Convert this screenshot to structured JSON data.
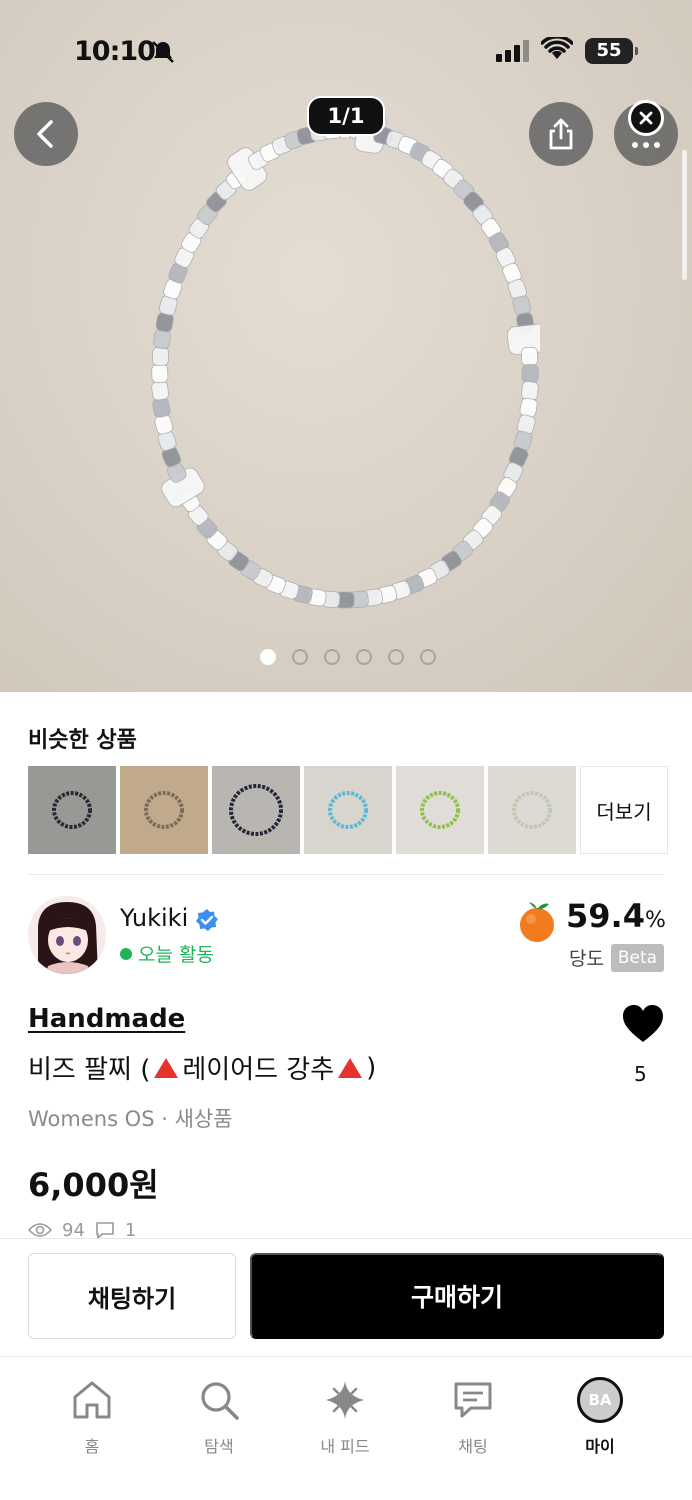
{
  "status_bar": {
    "time": "10:10",
    "battery": "55"
  },
  "gallery": {
    "counter": "1/1",
    "dot_count": 6,
    "active_dot": 0
  },
  "similar": {
    "title": "비슷한 상품",
    "more_label": "더보기",
    "thumb_bg_colors": [
      "#9a9895",
      "#c1aa8b",
      "#b9b6b1",
      "#d8d5cf",
      "#e0ddd8",
      "#ddd9d3"
    ],
    "thumb_bead_colors": [
      "#262a33",
      "#7b6a5b",
      "#222838",
      "#5db7d4",
      "#8fc04a",
      "#bfc8b0"
    ]
  },
  "seller": {
    "name": "Yukiki",
    "activity": "오늘 활동",
    "sweetness_value": "59.4",
    "sweetness_unit": "%",
    "sweetness_label": "당도",
    "beta_label": "Beta"
  },
  "product": {
    "brand": "Handmade",
    "title_prefix": "비즈 팔찌 (",
    "title_middle": "레이어드 강추",
    "title_suffix": ")",
    "meta": "Womens OS · 새상품",
    "price": "6,000원",
    "likes": "5",
    "views": "94",
    "comments": "1"
  },
  "actions": {
    "chat_label": "채팅하기",
    "buy_label": "구매하기"
  },
  "tabs": [
    {
      "label": "홈",
      "icon": "home-icon"
    },
    {
      "label": "탐색",
      "icon": "search-icon"
    },
    {
      "label": "내 피드",
      "icon": "sparkle-icon"
    },
    {
      "label": "채팅",
      "icon": "chat-icon"
    },
    {
      "label": "마이",
      "icon": "avatar-icon",
      "avatar_text": "BA"
    }
  ],
  "colors": {
    "accent_green": "#1fb45a",
    "verified_blue": "#3d8ef0",
    "warning_red": "#e5322d",
    "primary_black": "#000000"
  }
}
